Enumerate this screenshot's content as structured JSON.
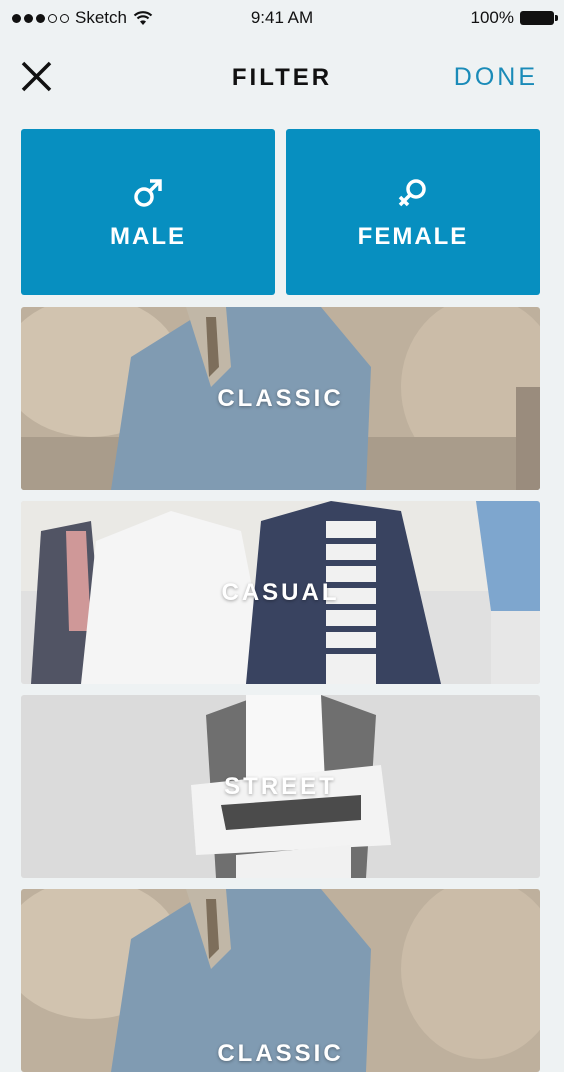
{
  "status_bar": {
    "carrier": "Sketch",
    "time": "9:41 AM",
    "battery": "100%"
  },
  "nav": {
    "title": "FILTER",
    "done_label": "DONE",
    "close_icon": "close-icon"
  },
  "gender": [
    {
      "label": "MALE",
      "icon": "male-symbol-icon"
    },
    {
      "label": "FEMALE",
      "icon": "female-symbol-icon"
    }
  ],
  "styles": [
    {
      "label": "CLASSIC"
    },
    {
      "label": "CASUAL"
    },
    {
      "label": "STREET"
    },
    {
      "label": "CLASSIC"
    }
  ],
  "colors": {
    "accent": "#078fc0",
    "done": "#1a8bb8",
    "background": "#eef2f3"
  }
}
